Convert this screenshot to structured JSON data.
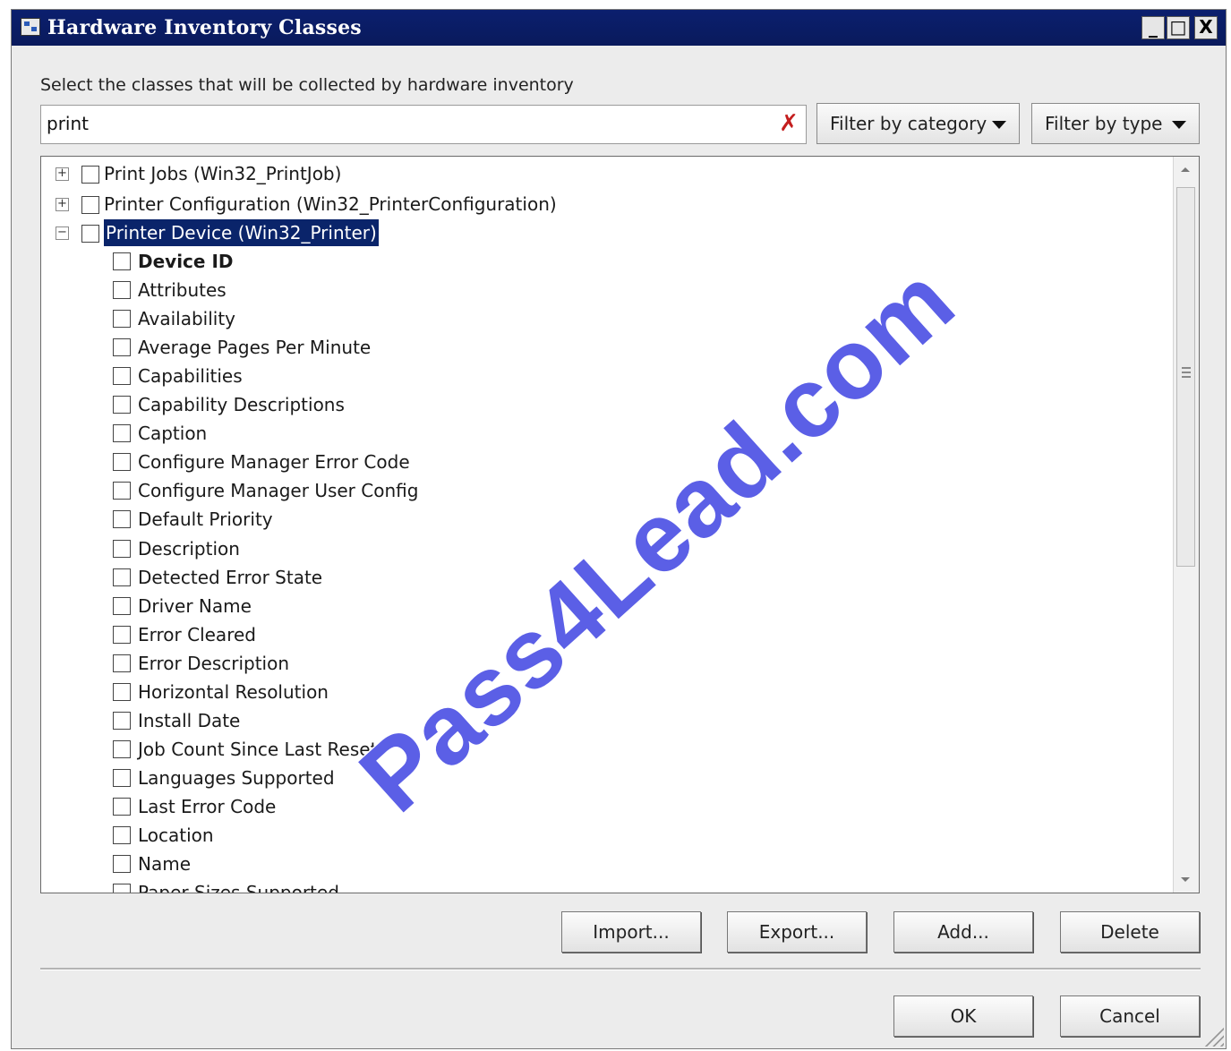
{
  "window": {
    "title": "Hardware Inventory Classes",
    "controls": {
      "minimize": "_",
      "maximize": "□",
      "close": "X"
    }
  },
  "prompt": "Select the classes that will be collected by hardware inventory",
  "search": {
    "value": "print",
    "clear_icon": "clear-x-icon"
  },
  "filters": {
    "category": "Filter by category",
    "type": "Filter by type"
  },
  "tree": {
    "classes": [
      {
        "expander": "+",
        "label": "Print Jobs (Win32_PrintJob)",
        "checked": false
      },
      {
        "expander": "+",
        "label": "Printer Configuration (Win32_PrinterConfiguration)",
        "checked": false
      },
      {
        "expander": "−",
        "label": "Printer Device (Win32_Printer)",
        "checked": false,
        "selected": true
      }
    ],
    "properties": [
      "Device ID",
      "Attributes",
      "Availability",
      "Average Pages Per Minute",
      "Capabilities",
      "Capability Descriptions",
      "Caption",
      "Configure Manager Error Code",
      "Configure Manager User Config",
      "Default Priority",
      "Description",
      "Detected Error State",
      "Driver Name",
      "Error Cleared",
      "Error Description",
      "Horizontal Resolution",
      "Install Date",
      "Job Count Since Last Reset",
      "Languages Supported",
      "Last Error Code",
      "Location",
      "Name",
      "Paper Sizes Supported"
    ]
  },
  "buttons": {
    "import": "Import...",
    "export": "Export...",
    "add": "Add...",
    "delete": "Delete",
    "ok": "OK",
    "cancel": "Cancel"
  },
  "watermark": "Pass4Lead.com",
  "colors": {
    "titlebar": "#0a1a5c",
    "selection": "#0a246a",
    "watermark": "#5b5fe6",
    "clear_icon": "#c41e1e"
  }
}
